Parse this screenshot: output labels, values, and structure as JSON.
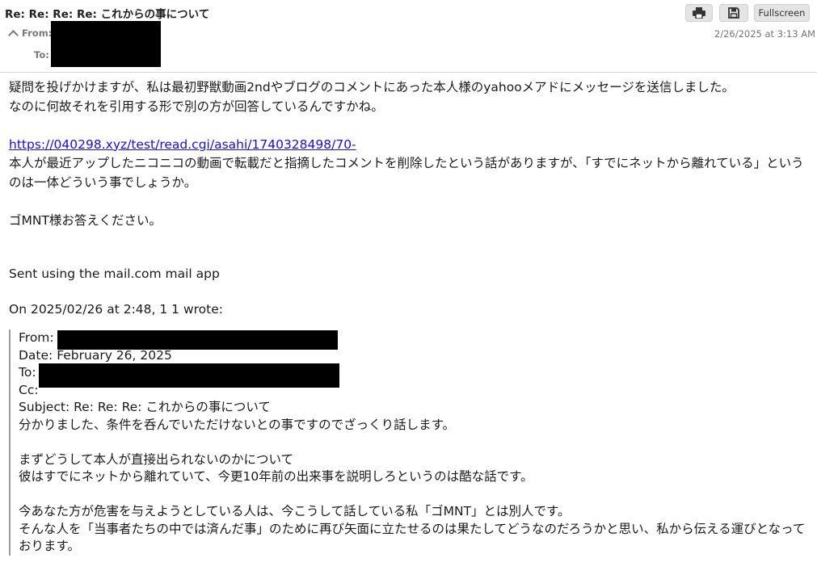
{
  "header": {
    "subject": "Re: Re: Re: Re: これからの事について",
    "from_label": "From:",
    "to_label": "To:",
    "date": "2/26/2025 at 3:13 AM",
    "buttons": {
      "print_icon": "printer-icon",
      "save_icon": "floppy-disk-icon",
      "fullscreen_label": "Fullscreen"
    }
  },
  "body": {
    "lines": [
      "疑問を投げかけますが、私は最初野獣動画2ndやブログのコメントにあった本人様のyahooメアドにメッセージを送信しました。",
      "なのに何故それを引用する形で別の方が回答しているんですかね。"
    ],
    "link": "https://040298.xyz/test/read.cgi/asahi/1740328498/70-",
    "para2": "本人が最近アップしたニコニコの動画で転載だと指摘したコメントを削除したという話がありますが、「すでにネットから離れている」というのは一体どういう事でしょうか。",
    "para3": "ゴMNT様お答えください。",
    "signature": "Sent using the mail.com mail app",
    "quote_intro": "On 2025/02/26 at 2:48, 1 1 wrote:"
  },
  "quote": {
    "from_label": "From:",
    "date_line": "Date: February 26, 2025",
    "to_label": "To:",
    "cc_label": "Cc:",
    "subject_line": "Subject: Re: Re: Re: これからの事について",
    "line1": "分かりました、条件を呑んでいただけないとの事ですのでざっくり話します。",
    "line2": "まずどうして本人が直接出られないのかについて",
    "line3": "彼はすでにネットから離れていて、今更10年前の出来事を説明しろというのは酷な話です。",
    "line4": "今あなた方が危害を与えようとしている人は、今こうして話している私「ゴMNT」とは別人です。",
    "line5": "そんな人を「当事者たちの中では済んだ事」のために再び矢面に立たせるのは果たしてどうなのだろうかと思い、私から伝える運びとなっております。"
  }
}
